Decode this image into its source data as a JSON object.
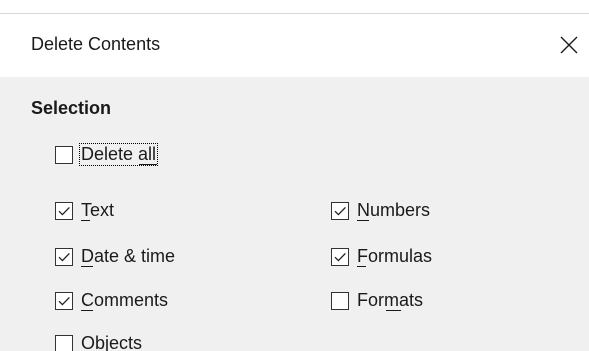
{
  "dialog": {
    "title": "Delete Contents",
    "close_icon": "close-icon",
    "close_glyph": "✕"
  },
  "selection": {
    "heading": "Selection",
    "delete_all": {
      "label": "Delete all",
      "checked": false
    },
    "left_column": [
      {
        "label": "Text",
        "checked": true
      },
      {
        "label": "Date & time",
        "checked": true
      },
      {
        "label": "Comments",
        "checked": true
      },
      {
        "label": "Objects",
        "checked": false
      }
    ],
    "right_column": [
      {
        "label": "Numbers",
        "checked": true
      },
      {
        "label": "Formulas",
        "checked": true
      },
      {
        "label": "Formats",
        "checked": false
      }
    ]
  }
}
